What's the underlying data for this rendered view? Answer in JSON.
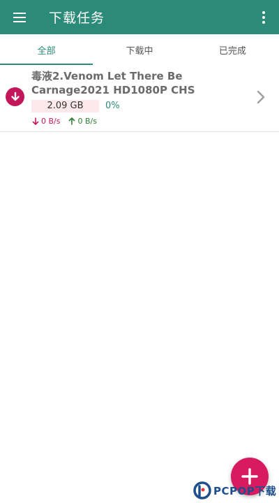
{
  "app_bar": {
    "title": "下载任务",
    "menu_icon": "menu-icon",
    "more_icon": "more-vert-icon",
    "color": "#2b8a78"
  },
  "tabs": [
    {
      "label": "全部",
      "active": true
    },
    {
      "label": "下载中",
      "active": false
    },
    {
      "label": "已完成",
      "active": false
    }
  ],
  "tasks": [
    {
      "name": "毒液2.Venom Let There Be Carnage2021 HD1080P CHS",
      "size": "2.09 GB",
      "progress": "0%",
      "download_speed": "0 B/s",
      "upload_speed": "0 B/s",
      "status_icon": "download-icon"
    }
  ],
  "fab": {
    "icon": "plus-icon",
    "color": "#d81b60"
  },
  "watermark": {
    "text": "PCPOP下载"
  }
}
